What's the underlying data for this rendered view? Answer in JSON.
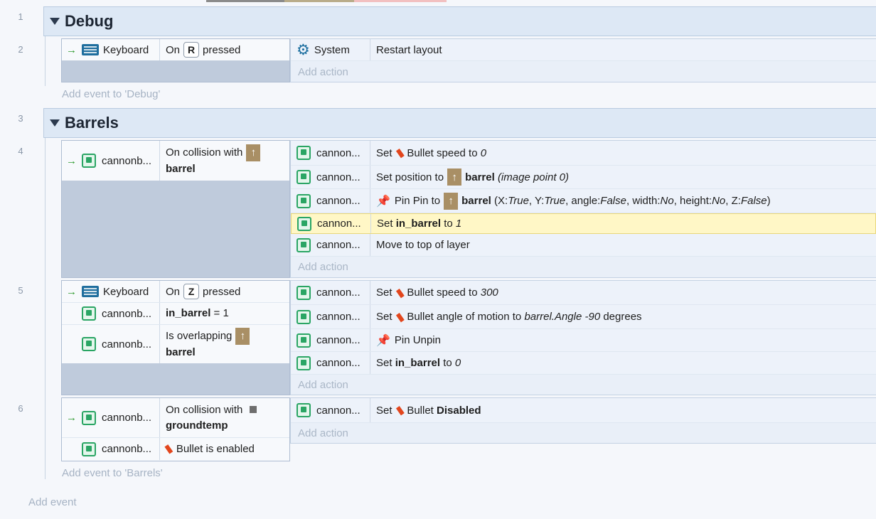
{
  "rows": [
    "1",
    "2",
    "3",
    "4",
    "5",
    "6"
  ],
  "debug": {
    "title": "Debug",
    "event": {
      "cond_object": "Keyboard",
      "cond_on": "On",
      "cond_key": "R",
      "cond_pressed": "pressed",
      "act_object": "System",
      "act_text": "Restart layout",
      "add_action": "Add action"
    },
    "add_event": "Add event to 'Debug'"
  },
  "barrels": {
    "title": "Barrels",
    "add_event": "Add event to 'Barrels'"
  },
  "ev4": {
    "cond_object": "cannonb...",
    "cond_text": "On collision with",
    "cond_target": "barrel",
    "act_object": "cannon...",
    "a1_set": "Set",
    "a1_beh": "Bullet speed to",
    "a1_val": "0",
    "a2_set": "Set position to",
    "a2_obj": "barrel",
    "a2_extra": "(image point 0)",
    "a3_pin": "Pin Pin to",
    "a3_obj": "barrel",
    "a3_x": "(X: ",
    "a3_true1": "True",
    "a3_y": ", Y: ",
    "a3_true2": "True",
    "a3_angle": ", angle: ",
    "a3_false1": "False",
    "a3_width": ", width: ",
    "a3_no1": "No",
    "a3_height": ", height: ",
    "a3_no2": "No",
    "a3_z": ", Z: ",
    "a3_false2": "False",
    "a3_close": ")",
    "a4_set": "Set",
    "a4_var": "in_barrel",
    "a4_to": "to",
    "a4_val": "1",
    "a5_text": "Move to top of layer",
    "add_action": "Add action"
  },
  "ev5": {
    "c1_object": "Keyboard",
    "c1_on": "On",
    "c1_key": "Z",
    "c1_pressed": "pressed",
    "c2_object": "cannonb...",
    "c2_var": "in_barrel",
    "c2_rest": "= 1",
    "c3_object": "cannonb...",
    "c3_text": "Is overlapping",
    "c3_target": "barrel",
    "act_object": "cannon...",
    "a1_set": "Set",
    "a1_beh": "Bullet speed to",
    "a1_val": "300",
    "a2_set": "Set",
    "a2_beh": "Bullet angle of motion to",
    "a2_val": "barrel.Angle -90",
    "a2_unit": "degrees",
    "a3_text": "Pin Unpin",
    "a4_set": "Set",
    "a4_var": "in_barrel",
    "a4_to": "to",
    "a4_val": "0",
    "add_action": "Add action"
  },
  "ev6": {
    "c1_object": "cannonb...",
    "c1_text": "On collision with",
    "c1_target": "groundtemp",
    "c2_object": "cannonb...",
    "c2_text": "Bullet is enabled",
    "act_object": "cannon...",
    "a1_set": "Set",
    "a1_beh": "Bullet",
    "a1_val": "Disabled",
    "add_action": "Add action"
  },
  "add_event": "Add event",
  "colors": {
    "group_bg": "#dde8f5",
    "highlight": "#fff7c6",
    "sprite": "#2aa564",
    "bullet": "#e2461d"
  }
}
